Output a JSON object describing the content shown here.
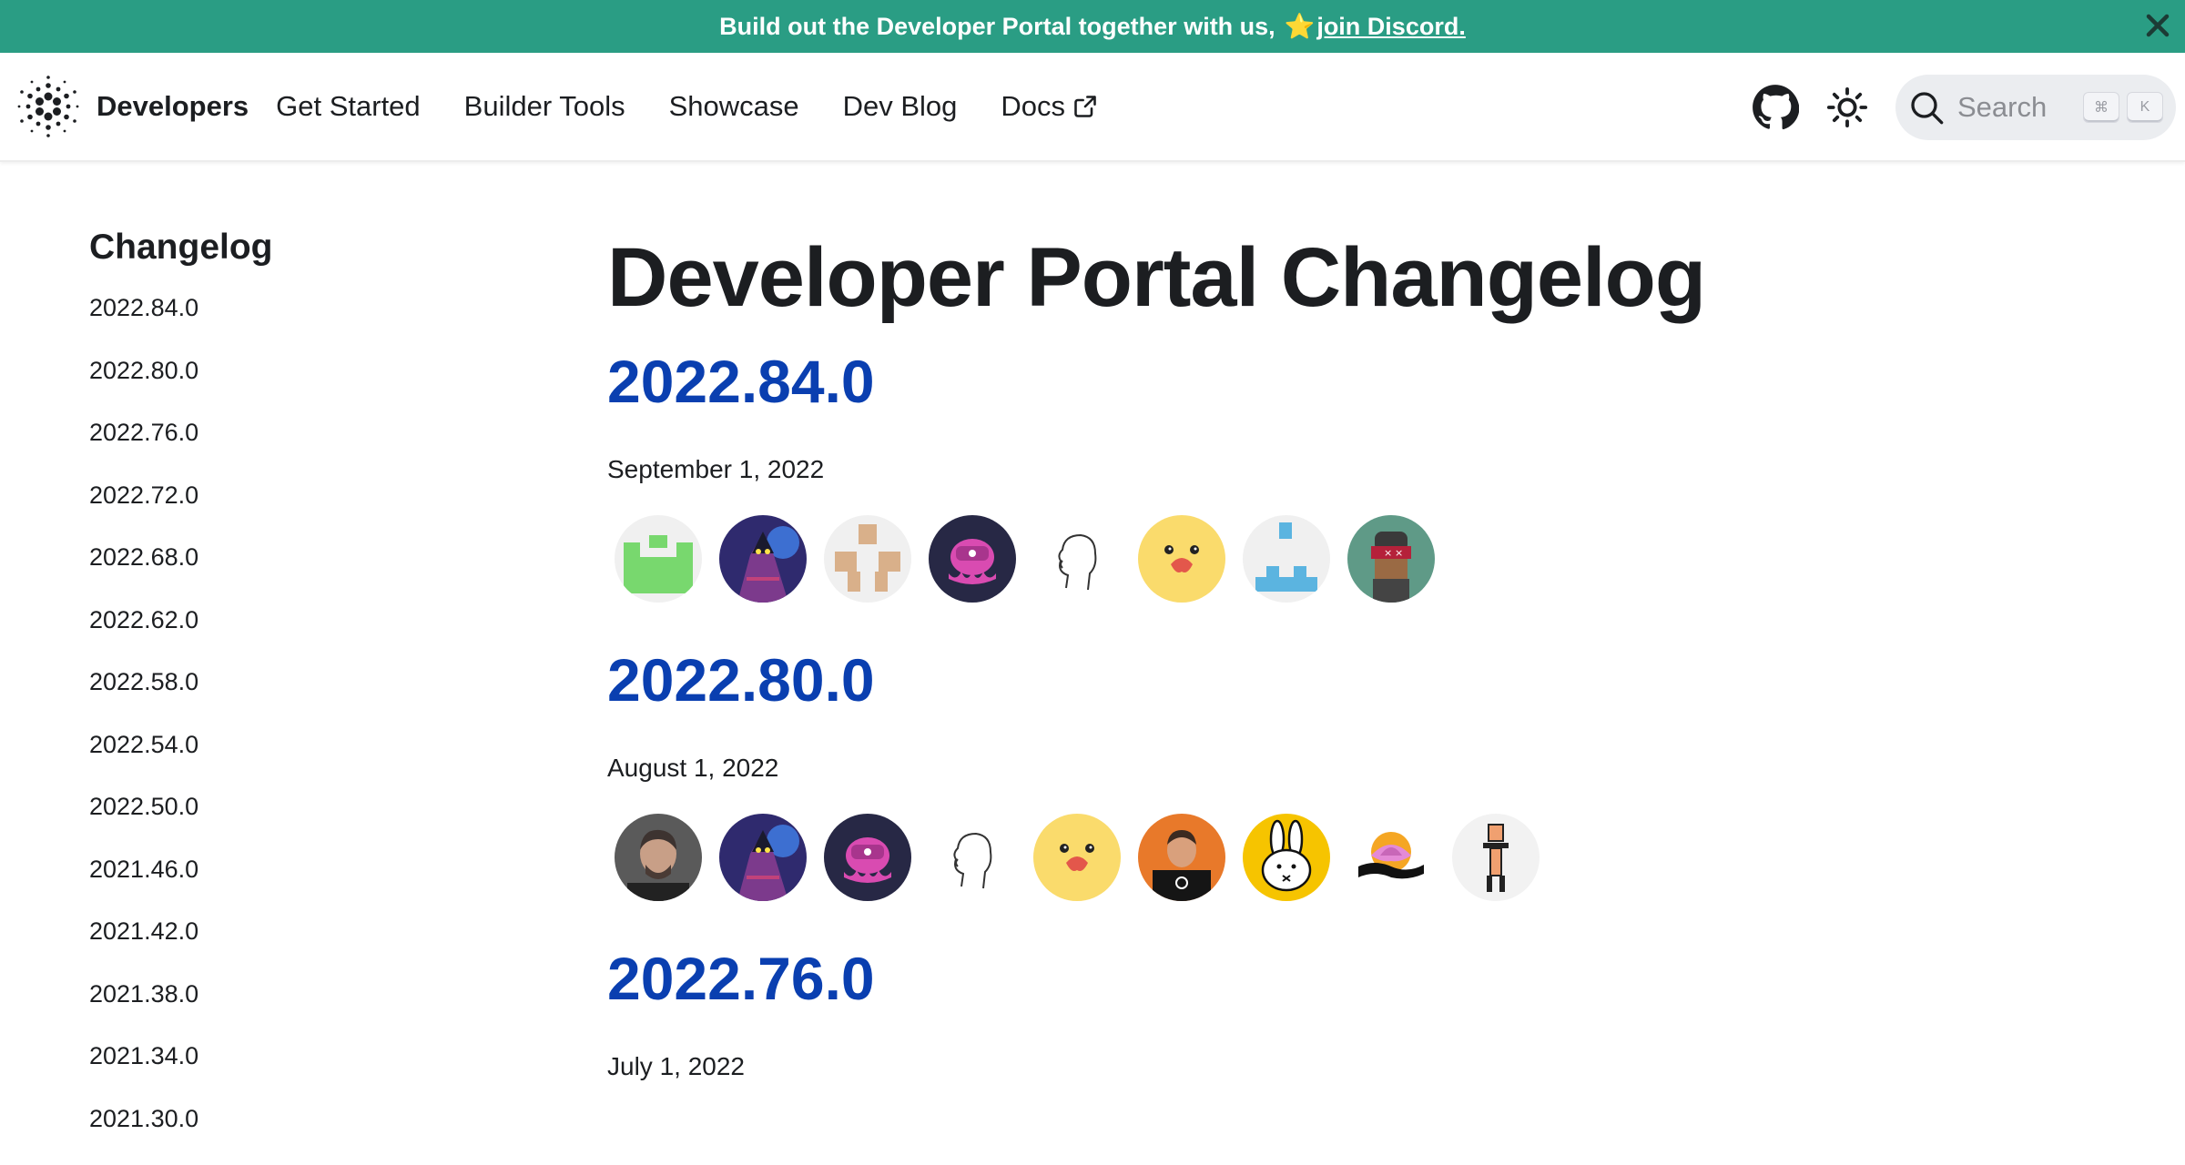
{
  "announcement": {
    "text": "Build out the Developer Portal together with us,",
    "star": "⭐",
    "link": "join Discord."
  },
  "navbar": {
    "brand": "Developers",
    "items": [
      {
        "label": "Get Started"
      },
      {
        "label": "Builder Tools"
      },
      {
        "label": "Showcase"
      },
      {
        "label": "Dev Blog"
      },
      {
        "label": "Docs",
        "external": true
      }
    ],
    "search": {
      "placeholder": "Search",
      "keys": [
        "⌘",
        "K"
      ]
    }
  },
  "sidebar": {
    "title": "Changelog",
    "items": [
      {
        "label": "2022.84.0"
      },
      {
        "label": "2022.80.0"
      },
      {
        "label": "2022.76.0"
      },
      {
        "label": "2022.72.0"
      },
      {
        "label": "2022.68.0"
      },
      {
        "label": "2022.62.0"
      },
      {
        "label": "2022.58.0"
      },
      {
        "label": "2022.54.0"
      },
      {
        "label": "2022.50.0"
      },
      {
        "label": "2021.46.0"
      },
      {
        "label": "2021.42.0"
      },
      {
        "label": "2021.38.0"
      },
      {
        "label": "2021.34.0"
      },
      {
        "label": "2021.30.0"
      }
    ]
  },
  "main": {
    "title": "Developer Portal Changelog",
    "releases": [
      {
        "version": "2022.84.0",
        "date": "September 1, 2022",
        "contributors": [
          "green-pixel-avatar",
          "wizard-avatar",
          "beige-pixel-avatar",
          "pink-octopus-avatar",
          "face-outline-avatar",
          "yellow-duck-avatar",
          "blue-pixel-avatar",
          "robot-teal-avatar"
        ]
      },
      {
        "version": "2022.80.0",
        "date": "August 1, 2022",
        "contributors": [
          "man-photo-avatar",
          "wizard-avatar",
          "pink-octopus-avatar",
          "face-outline-avatar",
          "yellow-duck-avatar",
          "orange-man-avatar",
          "white-bunny-avatar",
          "lotus-avatar",
          "pixel-figure-avatar"
        ]
      },
      {
        "version": "2022.76.0",
        "date": "July 1, 2022",
        "contributors": []
      }
    ]
  },
  "colors": {
    "announcement_bg": "#2a9d84",
    "link_blue": "#0a3fb0"
  }
}
